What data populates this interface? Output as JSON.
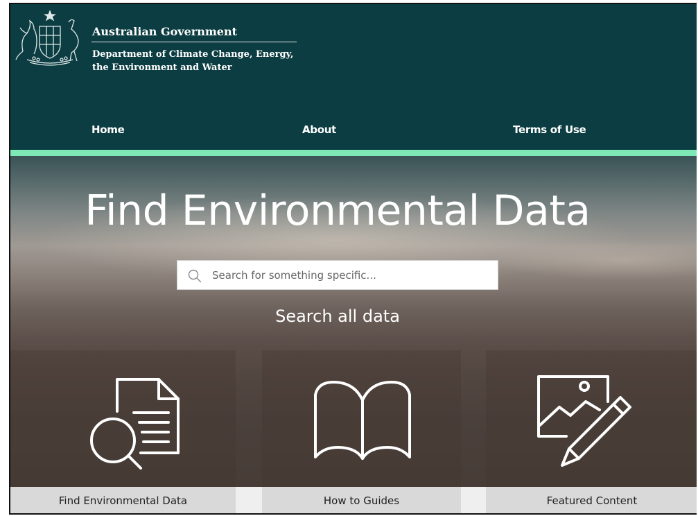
{
  "header": {
    "gov_title": "Australian Government",
    "department_line1": "Department of Climate Change, Energy,",
    "department_line2": "the Environment and Water"
  },
  "nav": {
    "items": [
      {
        "label": "Home"
      },
      {
        "label": "About"
      },
      {
        "label": "Terms of Use"
      }
    ]
  },
  "hero": {
    "title": "Find Environmental Data",
    "search_placeholder": "Search for something specific...",
    "search_all_link": "Search all data"
  },
  "tiles": [
    {
      "label": "Find Environmental Data",
      "icon": "document-search-icon"
    },
    {
      "label": "How to Guides",
      "icon": "open-book-icon"
    },
    {
      "label": "Featured Content",
      "icon": "image-edit-icon"
    }
  ],
  "colors": {
    "header_bg": "#0c3d42",
    "accent_bar": "#7ee7b6",
    "tile_label_bg": "#d9d9d9"
  }
}
